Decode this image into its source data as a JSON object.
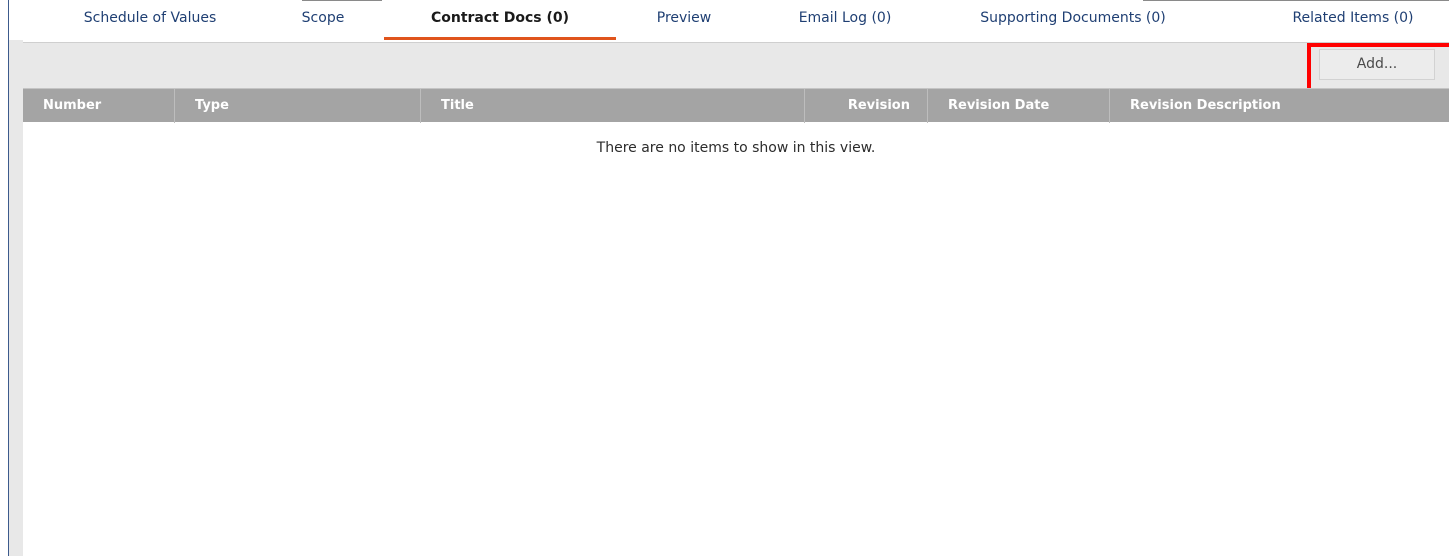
{
  "tabs": [
    {
      "label": "Schedule of Values"
    },
    {
      "label": "Scope"
    },
    {
      "label": "Contract Docs (0)",
      "active": true
    },
    {
      "label": "Preview"
    },
    {
      "label": "Email Log (0)"
    },
    {
      "label": "Supporting Documents (0)"
    },
    {
      "label": "Related Items (0)"
    }
  ],
  "toolbar": {
    "add_label": "Add..."
  },
  "table": {
    "columns": [
      {
        "label": "Number"
      },
      {
        "label": "Type"
      },
      {
        "label": "Title"
      },
      {
        "label": "Revision"
      },
      {
        "label": "Revision Date"
      },
      {
        "label": "Revision Description"
      }
    ],
    "rows": [],
    "empty_message": "There are no items to show in this view."
  },
  "colors": {
    "active_tab_underline": "#e0541c",
    "header_background": "#a4a4a4",
    "toolbar_background": "#e8e8e8",
    "highlight": "#ff0000",
    "tab_text": "#1f3f73"
  }
}
